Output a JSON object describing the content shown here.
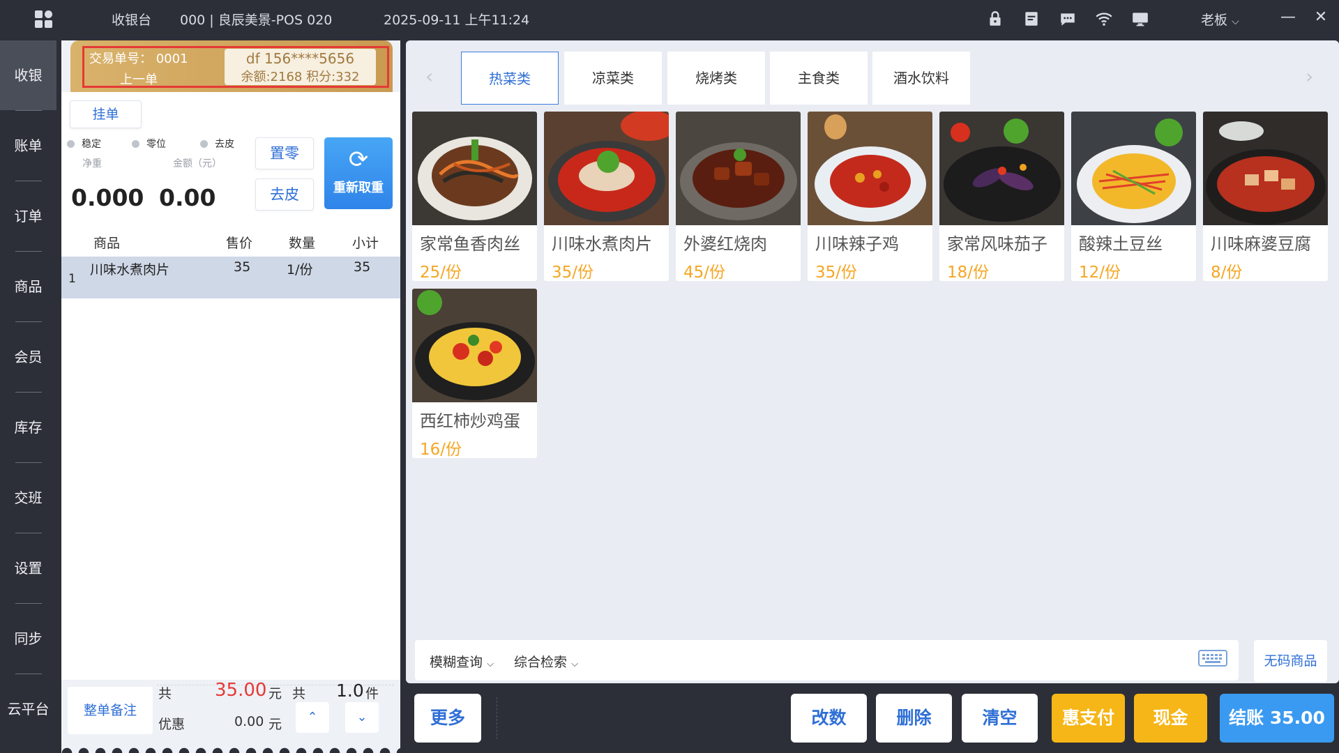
{
  "topbar": {
    "title": "收银台",
    "store": "000 | 良辰美景-POS 020",
    "datetime": "2025-09-11 上午11:24",
    "user": "老板",
    "icons": [
      "lock-icon",
      "receipt-icon",
      "chat-icon",
      "wifi-icon",
      "monitor-icon"
    ]
  },
  "nav": {
    "items": [
      {
        "label": "收银",
        "active": true
      },
      {
        "label": "账单"
      },
      {
        "label": "订单"
      },
      {
        "label": "商品"
      },
      {
        "label": "会员"
      },
      {
        "label": "库存"
      },
      {
        "label": "交班"
      },
      {
        "label": "设置"
      },
      {
        "label": "同步"
      },
      {
        "label": "云平台"
      }
    ]
  },
  "order": {
    "txn_label": "交易单号：  0001",
    "prev_label": "上一单",
    "member_line1": "df  156****5656",
    "member_line2": "余额:2168 积分:332",
    "hang_label": "挂单",
    "radios": [
      "稳定",
      "零位",
      "去皮"
    ],
    "net_weight_label": "净重",
    "amount_label": "金额（元）",
    "net_weight": "0.000",
    "amount": "0.00",
    "zero_btn": "置零",
    "tare_btn": "去皮",
    "reweigh_btn": "重新取重",
    "columns": [
      "商品",
      "售价",
      "数量",
      "小计"
    ],
    "rows": [
      {
        "index": "1",
        "name": "川味水煮肉片",
        "price": "35",
        "qty": "1/份",
        "subtotal": "35"
      }
    ],
    "note_btn": "整单备注",
    "total_prefix": "共",
    "total_amount": "35.00",
    "total_unit": "元",
    "count_prefix": "共",
    "count": "1.0",
    "count_unit": "件",
    "discount_label": "优惠",
    "discount_amount": "0.00",
    "discount_unit": "元"
  },
  "categories": {
    "tabs": [
      {
        "label": "热菜类",
        "active": true
      },
      {
        "label": "凉菜类"
      },
      {
        "label": "烧烤类"
      },
      {
        "label": "主食类"
      },
      {
        "label": "酒水饮料"
      }
    ]
  },
  "products": [
    {
      "name": "家常鱼香肉丝",
      "price": "25/份"
    },
    {
      "name": "川味水煮肉片",
      "price": "35/份"
    },
    {
      "name": "外婆红烧肉",
      "price": "45/份"
    },
    {
      "name": "川味辣子鸡",
      "price": "35/份"
    },
    {
      "name": "家常风味茄子",
      "price": "18/份"
    },
    {
      "name": "酸辣土豆丝",
      "price": "12/份"
    },
    {
      "name": "川味麻婆豆腐",
      "price": "8/份"
    },
    {
      "name": "西红柿炒鸡蛋",
      "price": "16/份"
    }
  ],
  "search": {
    "fuzzy": "模糊查询",
    "combined": "综合检索",
    "nocode_btn": "无码商品"
  },
  "actions": {
    "more": "更多",
    "modify_qty": "改数",
    "delete": "删除",
    "clear": "清空",
    "hui_pay": "惠支付",
    "cash": "现金",
    "checkout": "结账 35.00"
  },
  "colors": {
    "accent_blue": "#2f6fd6",
    "checkout_blue": "#3a9af1",
    "pay_orange": "#f6b617",
    "price_orange": "#f5a623",
    "header_gold": "#d9b26b",
    "total_red": "#e53935"
  }
}
